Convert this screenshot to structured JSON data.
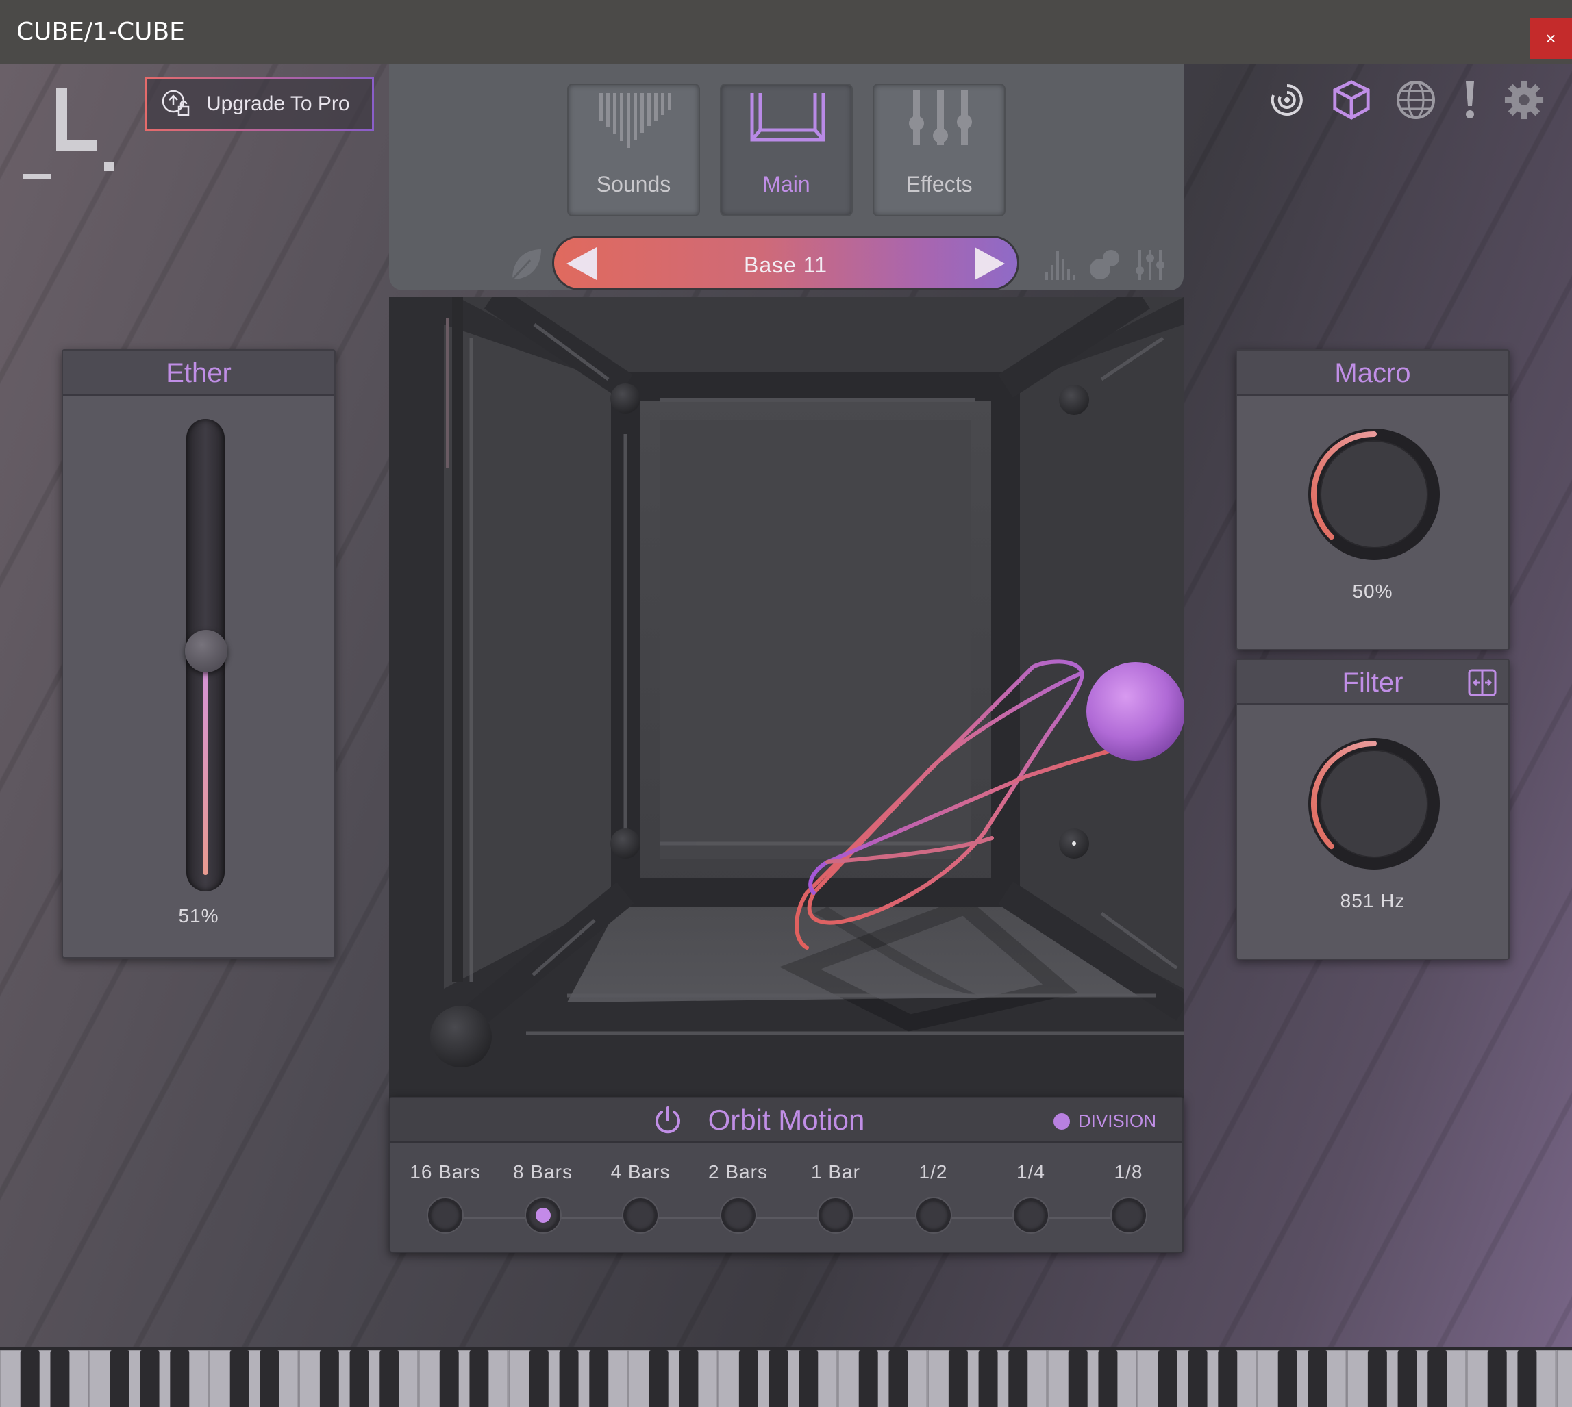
{
  "window": {
    "title": "CUBE/1-CUBE",
    "close_label": "×"
  },
  "header": {
    "upgrade_label": "Upgrade To Pro",
    "icons": [
      "orbit-icon",
      "cube-icon",
      "globe-icon",
      "alert-icon",
      "gear-icon"
    ]
  },
  "nav": {
    "tabs": [
      {
        "label": "Sounds",
        "icon": "sounds-icon",
        "active": false
      },
      {
        "label": "Main",
        "icon": "main-icon",
        "active": true
      },
      {
        "label": "Effects",
        "icon": "effects-icon",
        "active": false
      }
    ],
    "preset": {
      "name": "Base 11"
    },
    "mini_icons": [
      "leaf-icon",
      "spectrum-icon",
      "blob-icon",
      "mixer-icon"
    ]
  },
  "ether": {
    "title": "Ether",
    "value_label": "51%",
    "value": 0.51
  },
  "macro": {
    "title": "Macro",
    "value_label": "50%",
    "value": 0.5
  },
  "filter": {
    "title": "Filter",
    "value_label": "851 Hz",
    "value": 0.5,
    "icon": "link-icon"
  },
  "orbit": {
    "title": "Orbit Motion",
    "division_label": "DIVISION",
    "divisions": [
      {
        "label": "16 Bars",
        "selected": false
      },
      {
        "label": "8 Bars",
        "selected": true
      },
      {
        "label": "4 Bars",
        "selected": false
      },
      {
        "label": "2 Bars",
        "selected": false
      },
      {
        "label": "1 Bar",
        "selected": false
      },
      {
        "label": "1/2",
        "selected": false
      },
      {
        "label": "1/4",
        "selected": false
      },
      {
        "label": "1/8",
        "selected": false
      }
    ]
  },
  "colors": {
    "accent": "#c08ee6",
    "coral": "#e06a5e",
    "close": "#c42b2b"
  }
}
